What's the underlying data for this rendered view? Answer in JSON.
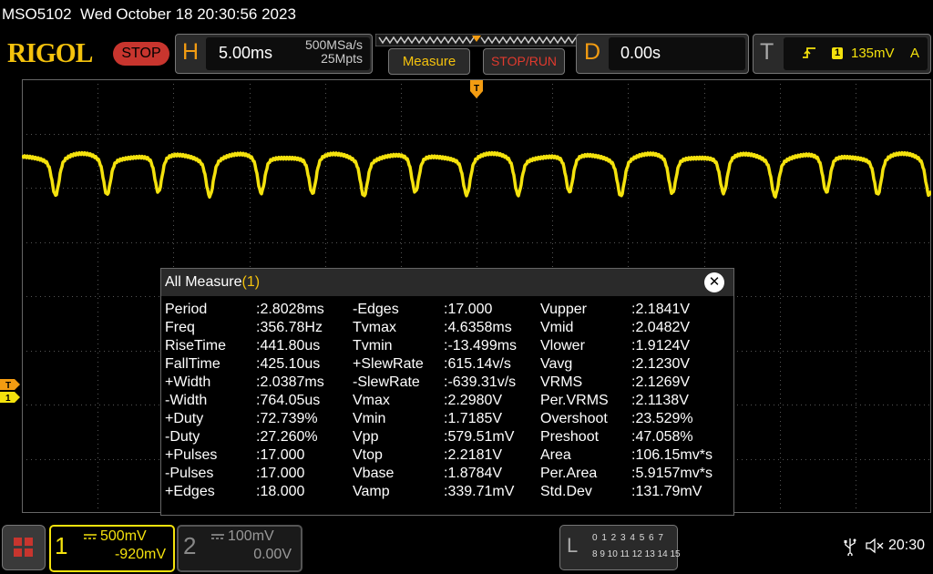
{
  "header": {
    "model": "MSO5102",
    "datetime": "Wed October 18 20:30:56 2023",
    "brand": "RIGOL",
    "run_state": "STOP"
  },
  "horizontal": {
    "letter": "H",
    "timebase": "5.00ms",
    "sample_rate": "500MSa/s",
    "memory_depth": "25Mpts"
  },
  "softkeys": {
    "measure": "Measure",
    "stop_run": "STOP/RUN"
  },
  "delay": {
    "letter": "D",
    "value": "0.00s"
  },
  "trigger": {
    "letter": "T",
    "source": "1",
    "level": "135mV",
    "mode": "A"
  },
  "colors": {
    "ch1": "#f4e20d",
    "trigger": "#f39c12",
    "stop": "#c8352e"
  },
  "markers": {
    "trigger_level": "T",
    "ch1": "1"
  },
  "measure_window": {
    "title": "All Measure",
    "count": "(1)",
    "close_glyph": "✕",
    "columns": [
      [
        {
          "name": "Period",
          "value": ":2.8028ms"
        },
        {
          "name": "Freq",
          "value": ":356.78Hz"
        },
        {
          "name": "RiseTime",
          "value": ":441.80us"
        },
        {
          "name": "FallTime",
          "value": ":425.10us"
        },
        {
          "name": "+Width",
          "value": ":2.0387ms"
        },
        {
          "name": "-Width",
          "value": ":764.05us"
        },
        {
          "name": "+Duty",
          "value": ":72.739%"
        },
        {
          "name": "-Duty",
          "value": ":27.260%"
        },
        {
          "name": "+Pulses",
          "value": ":17.000"
        },
        {
          "name": "-Pulses",
          "value": ":17.000"
        },
        {
          "name": "+Edges",
          "value": ":18.000"
        }
      ],
      [
        {
          "name": "-Edges",
          "value": ":17.000"
        },
        {
          "name": "Tvmax",
          "value": ":4.6358ms"
        },
        {
          "name": "Tvmin",
          "value": ":-13.499ms"
        },
        {
          "name": "+SlewRate",
          "value": ":615.14v/s"
        },
        {
          "name": "-SlewRate",
          "value": ":-639.31v/s"
        },
        {
          "name": "Vmax",
          "value": ":2.2980V"
        },
        {
          "name": "Vmin",
          "value": ":1.7185V"
        },
        {
          "name": "Vpp",
          "value": ":579.51mV"
        },
        {
          "name": "Vtop",
          "value": ":2.2181V"
        },
        {
          "name": "Vbase",
          "value": ":1.8784V"
        },
        {
          "name": "Vamp",
          "value": ":339.71mV"
        }
      ],
      [
        {
          "name": "Vupper",
          "value": ":2.1841V"
        },
        {
          "name": "Vmid",
          "value": ":2.0482V"
        },
        {
          "name": "Vlower",
          "value": ":1.9124V"
        },
        {
          "name": "Vavg",
          "value": ":2.1230V"
        },
        {
          "name": "VRMS",
          "value": ":2.1269V"
        },
        {
          "name": "Per.VRMS",
          "value": ":2.1138V"
        },
        {
          "name": "Overshoot",
          "value": ":23.529%"
        },
        {
          "name": "Preshoot",
          "value": ":47.058%"
        },
        {
          "name": "Area",
          "value": ":106.15mv*s"
        },
        {
          "name": "Per.Area",
          "value": ":5.9157mv*s"
        },
        {
          "name": "Std.Dev",
          "value": ":131.79mV"
        }
      ]
    ]
  },
  "channels": [
    {
      "num": "1",
      "scale": "500mV",
      "offset": "-920mV",
      "active": true
    },
    {
      "num": "2",
      "scale": "100mV",
      "offset": "0.00V",
      "active": false
    }
  ],
  "logic_analyzer": {
    "letter": "L",
    "row1": "0 1 2 3   4 5 6 7",
    "row2": "8 9 10 11  12 13 14 15"
  },
  "status": {
    "time": "20:30"
  }
}
